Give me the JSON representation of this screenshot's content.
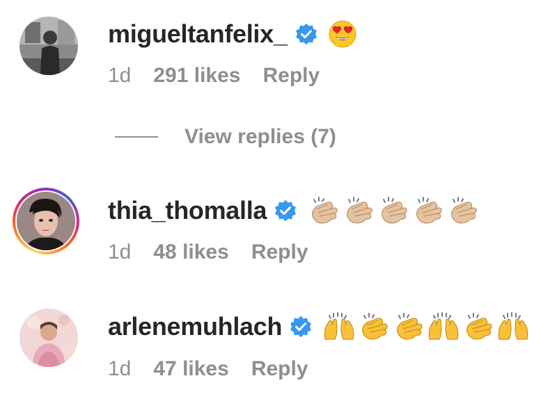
{
  "comments": [
    {
      "username": "migueltanfelix_",
      "verified": true,
      "emojis": [
        "heart-eyes"
      ],
      "time": "1d",
      "likes": "291 likes",
      "reply": "Reply"
    },
    {
      "username": "thia_thomalla",
      "verified": true,
      "emojis": [
        "clapping-hands",
        "clapping-hands",
        "clapping-hands",
        "clapping-hands",
        "clapping-hands"
      ],
      "time": "1d",
      "likes": "48 likes",
      "reply": "Reply"
    },
    {
      "username": "arlenemuhlach",
      "verified": true,
      "emojis": [
        "raising-hands",
        "clapping-hands",
        "clapping-hands",
        "raising-hands",
        "clapping-hands",
        "raising-hands"
      ],
      "time": "1d",
      "likes": "47 likes",
      "reply": "Reply"
    }
  ],
  "view_replies": "View replies (7)",
  "colors": {
    "verified": "#3897f0",
    "text": "#262626",
    "muted": "#8e8e8e"
  }
}
